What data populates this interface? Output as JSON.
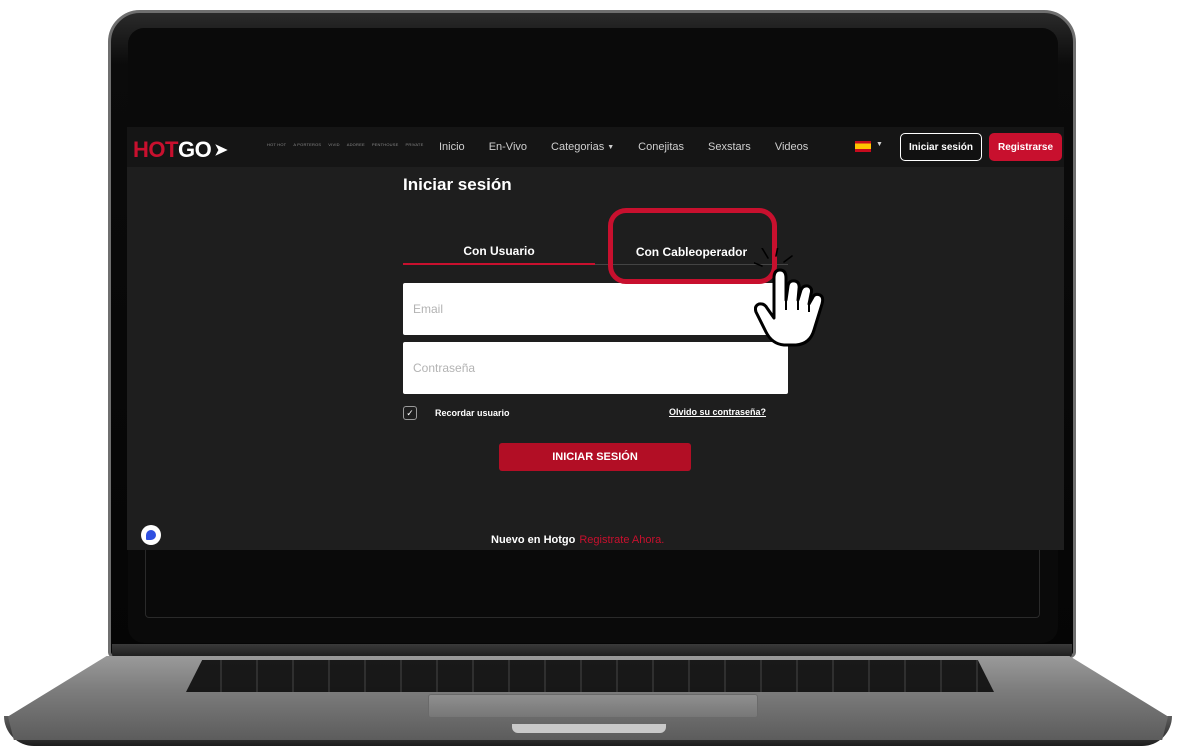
{
  "nav": {
    "logo_hot": "HOT",
    "logo_go": "GO",
    "partners": [
      "HOT HOT",
      "A PORTEROS",
      "Vivid",
      "ADOREE",
      "PENTHOUSE",
      "PRIVATE"
    ],
    "links": [
      "Inicio",
      "En-Vivo",
      "Categorias",
      "Conejitas",
      "Sexstars",
      "Videos"
    ],
    "language_flag": "spain-flag-icon",
    "login_button": "Iniciar sesión",
    "register_button": "Registrarse"
  },
  "login": {
    "title": "Iniciar sesión",
    "tabs": [
      "Con Usuario",
      "Con Cableoperador"
    ],
    "active_tab": "Con Usuario",
    "email_placeholder": "Email",
    "password_placeholder": "Contraseña",
    "remember_label": "Recordar usuario",
    "remember_checked": true,
    "forgot_link": "Olvido su contraseña?",
    "submit_button": "INICIAR SESIÓN",
    "signup_text": "Nuevo en Hotgo",
    "signup_link": "Registrate Ahora."
  },
  "chat_widget": "chat-bubble-icon",
  "overlay": {
    "highlight_target": "Con Cableoperador",
    "cursor": "hand-pointer-icon"
  },
  "colors": {
    "accent": "#c8102e",
    "background": "#1e1e1e",
    "navbar": "#151515"
  }
}
